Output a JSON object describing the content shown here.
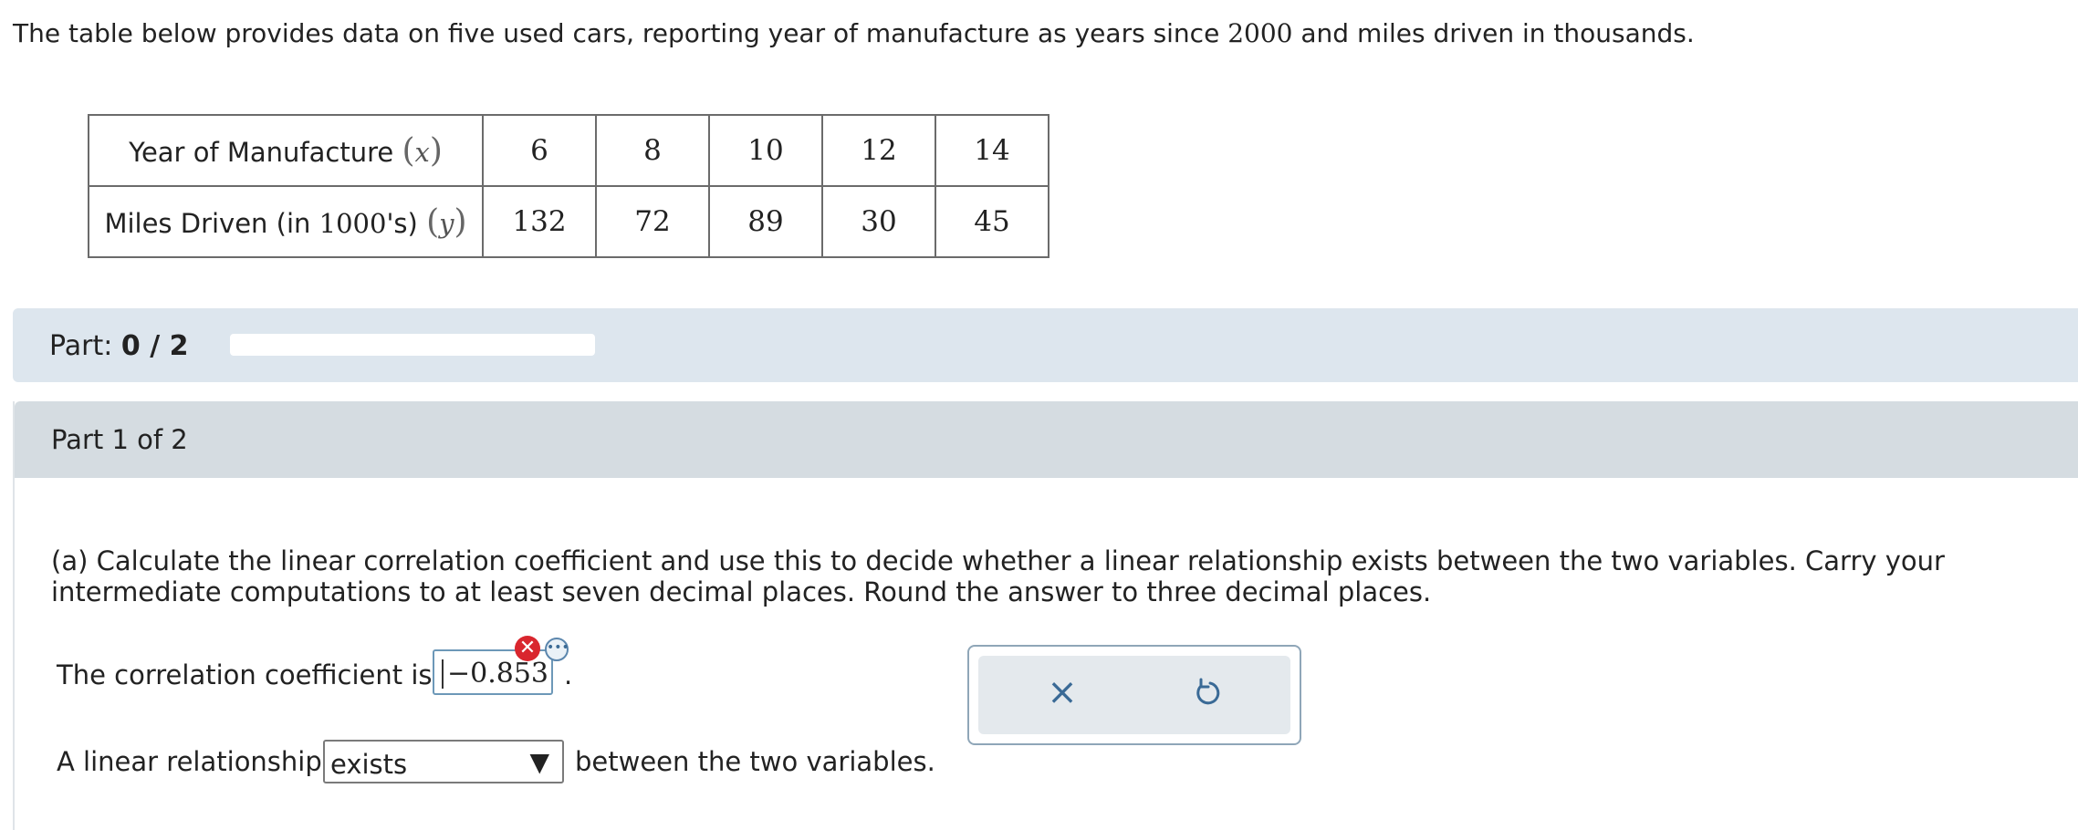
{
  "intro": {
    "text_before": "The table below provides data on five used cars, reporting year of manufacture as years since ",
    "year_base": "2000",
    "text_after": " and miles driven in thousands."
  },
  "table": {
    "row_x": {
      "label": "Year of Manufacture ",
      "var": "x",
      "values": [
        "6",
        "8",
        "10",
        "12",
        "14"
      ]
    },
    "row_y": {
      "label_before": "Miles Driven (in ",
      "label_num": "1000",
      "label_after": "'s) ",
      "var": "y",
      "values": [
        "132",
        "72",
        "89",
        "30",
        "45"
      ]
    }
  },
  "part_bar": {
    "label": "Part: ",
    "progress_text": "0 / 2",
    "progress_fraction": 0
  },
  "part_header": "Part 1 of 2",
  "question": "(a) Calculate the linear correlation coefficient and use this to decide whether a linear relationship exists between the two variables. Carry your intermediate computations to at least seven decimal places. Round the answer to three decimal places.",
  "corr": {
    "prefix": "The correlation coefficient is",
    "answer": "−0.853",
    "suffix": "."
  },
  "relationship": {
    "prefix": "A linear relationship",
    "selected": "exists",
    "suffix": "between the two variables."
  },
  "icons": {
    "wrong": "x-mark",
    "more": "ellipsis",
    "clear": "close",
    "reset": "undo"
  },
  "colors": {
    "error": "#d9262e",
    "accent": "#3a6a96",
    "part_bar_bg": "#dde6ee",
    "part_header_bg": "#d5dce1"
  }
}
